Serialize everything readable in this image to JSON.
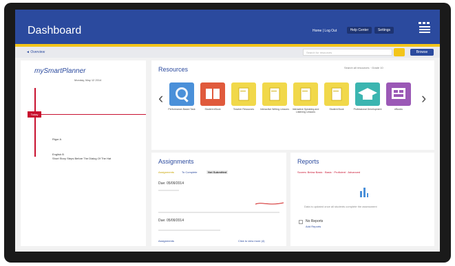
{
  "header": {
    "title": "Dashboard",
    "links": "Home | Log Out",
    "help_center": "Help Center",
    "settings": "Settings"
  },
  "subbar": {
    "breadcrumb": "◄ Overview",
    "search_placeholder": "Search for resources",
    "browse": "Browse"
  },
  "planner": {
    "title": "mySmartPlanner",
    "date": "Monday, May 12 2014",
    "today_tag": "Today",
    "events": [
      "Rigor A",
      "English B",
      "Short Story Steps Before The Dialog Of The Hat"
    ]
  },
  "resources": {
    "title": "Resources",
    "filter": "Search all resources · Grade 10",
    "items": [
      {
        "label": "Performance-Based Task",
        "color": "#4a90d9",
        "icon": "search-badge-icon"
      },
      {
        "label": "Student eBook",
        "color": "#e05a3c",
        "icon": "book-icon"
      },
      {
        "label": "Teacher Resources",
        "color": "#f1d84a",
        "icon": "document-icon"
      },
      {
        "label": "Interactive Writing Lessons",
        "color": "#f1d84a",
        "icon": "document-icon"
      },
      {
        "label": "Interactive Speaking and Listening Lessons",
        "color": "#f1d84a",
        "icon": "document-icon"
      },
      {
        "label": "Student Book",
        "color": "#f1d84a",
        "icon": "document-icon"
      },
      {
        "label": "Professional Development",
        "color": "#3bb5b0",
        "icon": "graduation-cap-icon"
      },
      {
        "label": "eBooks",
        "color": "#9b59b6",
        "icon": "screen-icon"
      }
    ]
  },
  "assignments": {
    "title": "Assignments",
    "tabs": [
      "Assignments",
      "To Complete",
      "Not Submitted"
    ],
    "items": [
      {
        "due": "Due: 05/09/2014"
      },
      {
        "due": "Due: 05/09/2014"
      }
    ],
    "footer_left": "Assignments",
    "footer_right": "Click to view more (4)"
  },
  "reports": {
    "title": "Reports",
    "legend": "Scores: Below Basic · Basic · Proficient · Advanced",
    "note": "Data is updated once all students complete the assessment",
    "no_reports": "No Reports",
    "no_reports_sub": "Add Reports"
  },
  "colors": {
    "brand": "#2b4a9e",
    "accent": "#f3c51a",
    "today": "#c8102e"
  }
}
